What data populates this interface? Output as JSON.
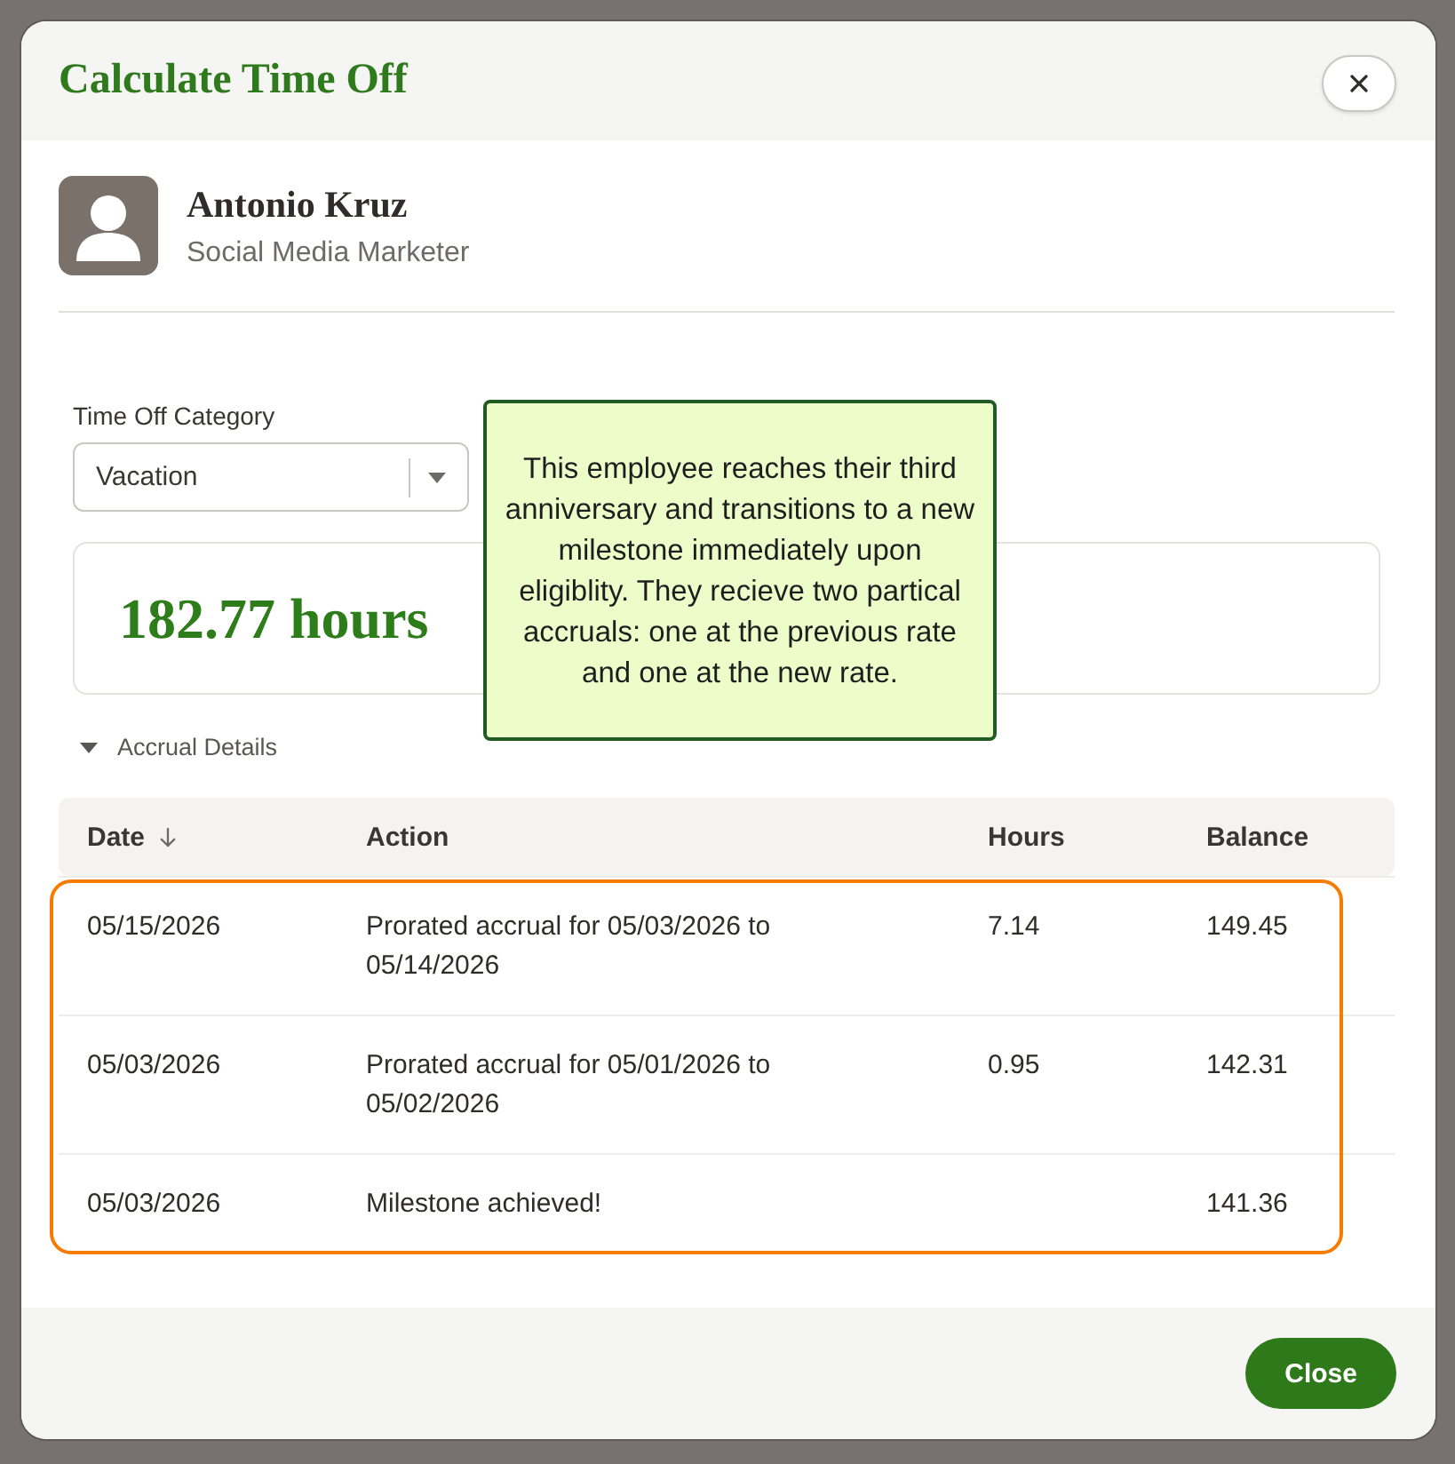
{
  "window": {
    "title": "Calculate Time Off"
  },
  "employee": {
    "name": "Antonio Kruz",
    "job_title": "Social Media Marketer"
  },
  "category": {
    "label": "Time Off Category",
    "value": "Vacation"
  },
  "balance": {
    "value": "182.77 hours"
  },
  "callout": {
    "text": "This employee reaches their third anniversary and transitions to a new milestone immediately upon eligiblity. They recieve two partical accruals: one at the previous rate and one at the new rate."
  },
  "accrual_details": {
    "label": "Accrual Details",
    "expanded": true
  },
  "table": {
    "columns": [
      {
        "label": "Date",
        "sorted": true
      },
      {
        "label": "Action",
        "sorted": false
      },
      {
        "label": "Hours",
        "sorted": false
      },
      {
        "label": "Balance",
        "sorted": false
      }
    ],
    "rows": [
      {
        "date": "05/15/2026",
        "action": "Prorated accrual for 05/03/2026 to 05/14/2026",
        "hours": "7.14",
        "balance": "149.45",
        "highlighted": true
      },
      {
        "date": "05/03/2026",
        "action": "Prorated accrual for 05/01/2026 to 05/02/2026",
        "hours": "0.95",
        "balance": "142.31",
        "highlighted": true
      },
      {
        "date": "05/03/2026",
        "action": "Milestone achieved!",
        "balance": "141.36",
        "highlighted": true
      }
    ]
  },
  "footer": {
    "buttons": [
      "Close"
    ]
  }
}
